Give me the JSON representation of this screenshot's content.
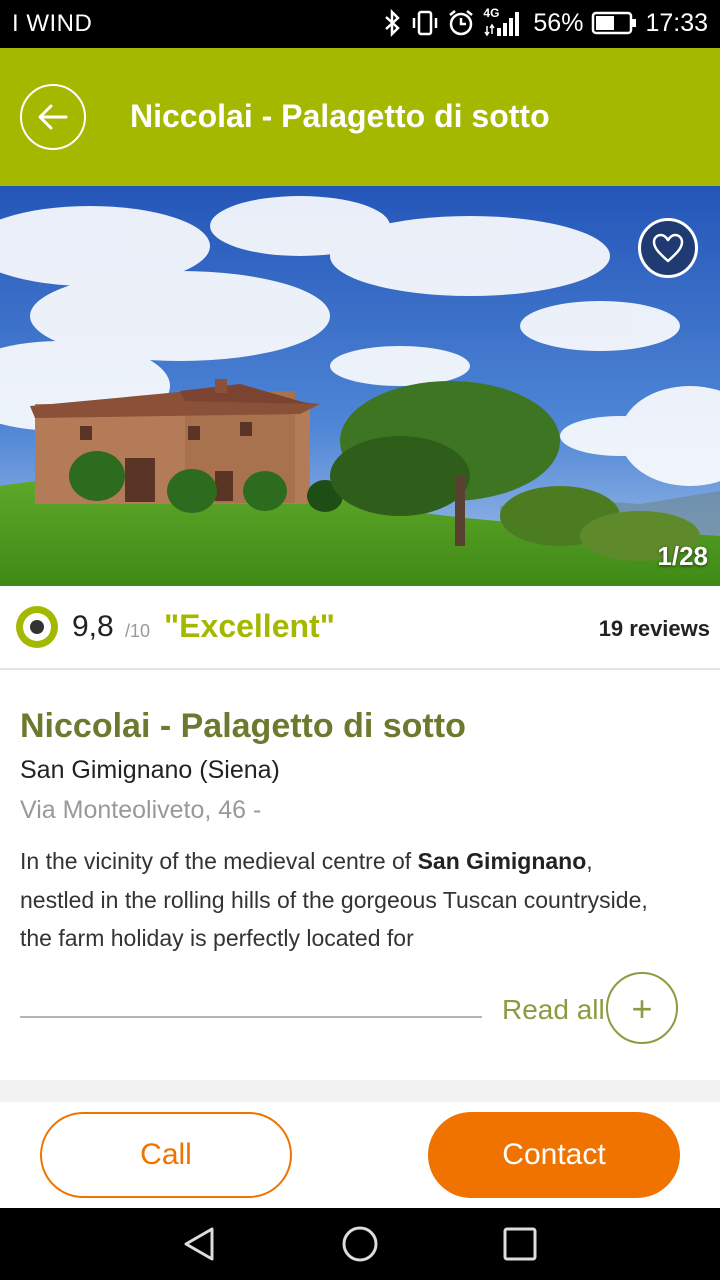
{
  "status_bar": {
    "carrier": "I WIND",
    "network": "4G",
    "battery": "56%",
    "time": "17:33"
  },
  "header": {
    "title": "Niccolai - Palagetto di sotto",
    "back_icon": "arrow-left-icon"
  },
  "gallery": {
    "counter": "1/28",
    "favorite_icon": "heart-icon"
  },
  "rating": {
    "score": "9,8",
    "scale": "/10",
    "label": "\"Excellent\"",
    "reviews": "19 reviews"
  },
  "property": {
    "name": "Niccolai - Palagetto di sotto",
    "city": "San Gimignano (Siena)",
    "address": "Via Monteoliveto, 46 -",
    "description_before": "In the vicinity of the medieval centre of ",
    "description_bold": "San Gimignano",
    "description_after": ", nestled in the rolling hills of the gorgeous Tuscan countryside, the farm holiday is perfectly located for",
    "read_all": "Read all",
    "read_all_icon": "+"
  },
  "actions": {
    "call": "Call",
    "contact": "Contact"
  },
  "colors": {
    "brand_green": "#a5b800",
    "title_green": "#6b7a2e",
    "accent_orange": "#f07300"
  }
}
